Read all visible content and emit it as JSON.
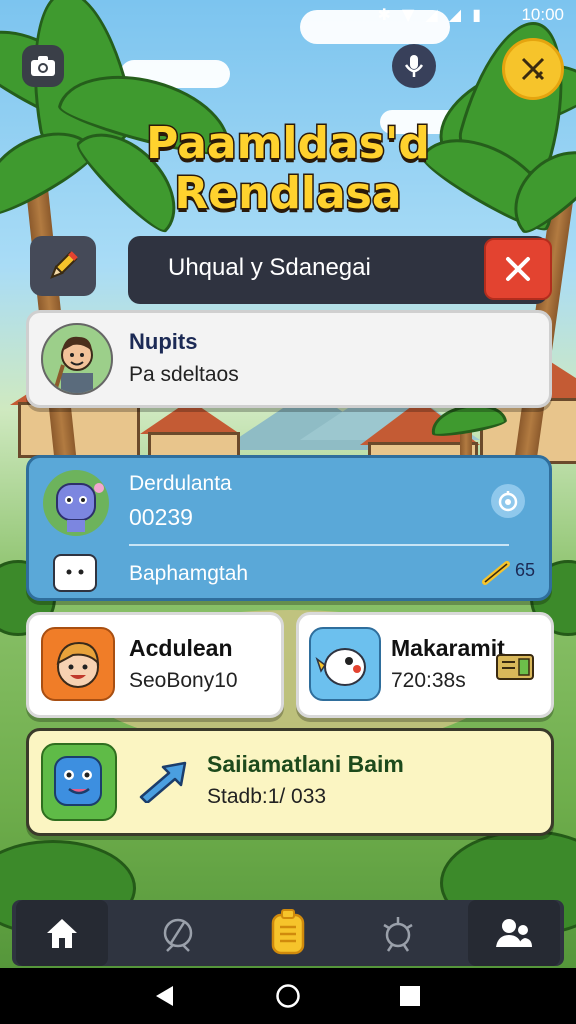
{
  "status_bar": {
    "time": "10:00",
    "icons": "✱ ▼ ◢ ◢ ▮"
  },
  "title": {
    "line1": "Paamldas'd",
    "line2": "Rendlasa"
  },
  "header": {
    "text": "Uhqual  y Sdanegai"
  },
  "profile": {
    "name": "Nupits",
    "subtitle": "Pa sdeltaos"
  },
  "blue_card": {
    "name": "Derdulanta",
    "value": "00239",
    "footer": "Baphamgtah",
    "end_badge": "65"
  },
  "card_left": {
    "title": "Acdulean",
    "subtitle": "SeoBony10"
  },
  "card_right": {
    "title": "Makaramit",
    "subtitle": "720:38s"
  },
  "yellow_card": {
    "title": "Saiiamatlani Baim",
    "subtitle": "Stadb:1/ 033"
  },
  "nav": {
    "items": [
      "home-icon",
      "compass-icon",
      "scroll-icon",
      "gear-icon",
      "friends-icon"
    ],
    "active": "home-icon"
  },
  "colors": {
    "accent_gold": "#f6c42b",
    "close_red": "#e34330",
    "blue_card": "#5aa8d8",
    "yellow_card": "#fbf5c2",
    "dark_panel": "#2f3340"
  }
}
